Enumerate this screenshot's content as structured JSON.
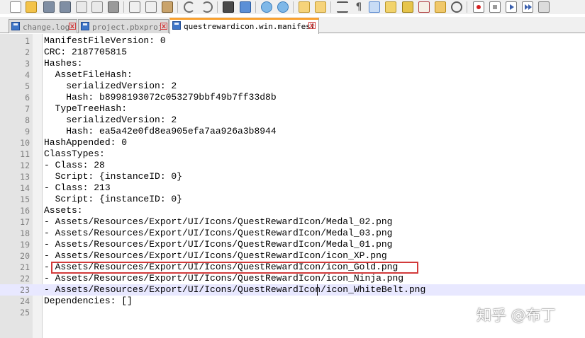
{
  "toolbar": {
    "icons": [
      "new-file-icon",
      "open-file-icon",
      "save-icon",
      "save-all-icon",
      "close-icon",
      "close-all-icon",
      "print-icon",
      "cut-icon",
      "copy-icon",
      "paste-icon",
      "undo-icon",
      "redo-icon",
      "find-icon",
      "replace-icon",
      "zoom-in-icon",
      "zoom-out-icon",
      "sync-vertical-icon",
      "sync-horizontal-icon",
      "word-wrap-icon",
      "show-all-characters-icon",
      "indent-guide-icon",
      "document-map-icon",
      "function-list-icon",
      "folder-as-workspace-icon",
      "monitoring-icon",
      "record-macro-icon",
      "stop-macro-icon",
      "play-macro-icon",
      "run-macro-multiple-icon",
      "save-macro-icon"
    ]
  },
  "tabs": [
    {
      "label": "change.log",
      "active": false
    },
    {
      "label": "project.pbxproj",
      "active": false
    },
    {
      "label": "questrewardicon.win.manifest",
      "active": true
    }
  ],
  "editor": {
    "current_line": 23,
    "highlighted_line": 21,
    "lines": [
      {
        "n": "1",
        "text": "ManifestFileVersion: 0"
      },
      {
        "n": "2",
        "text": "CRC: 2187705815"
      },
      {
        "n": "3",
        "text": "Hashes:"
      },
      {
        "n": "4",
        "text": "  AssetFileHash:"
      },
      {
        "n": "5",
        "text": "    serializedVersion: 2"
      },
      {
        "n": "6",
        "text": "    Hash: b8998193072c053279bbf49b7ff33d8b"
      },
      {
        "n": "7",
        "text": "  TypeTreeHash:"
      },
      {
        "n": "8",
        "text": "    serializedVersion: 2"
      },
      {
        "n": "9",
        "text": "    Hash: ea5a42e0fd8ea905efa7aa926a3b8944"
      },
      {
        "n": "10",
        "text": "HashAppended: 0"
      },
      {
        "n": "11",
        "text": "ClassTypes:"
      },
      {
        "n": "12",
        "text": "- Class: 28"
      },
      {
        "n": "13",
        "text": "  Script: {instanceID: 0}"
      },
      {
        "n": "14",
        "text": "- Class: 213"
      },
      {
        "n": "15",
        "text": "  Script: {instanceID: 0}"
      },
      {
        "n": "16",
        "text": "Assets:"
      },
      {
        "n": "17",
        "text": "- Assets/Resources/Export/UI/Icons/QuestRewardIcon/Medal_02.png"
      },
      {
        "n": "18",
        "text": "- Assets/Resources/Export/UI/Icons/QuestRewardIcon/Medal_03.png"
      },
      {
        "n": "19",
        "text": "- Assets/Resources/Export/UI/Icons/QuestRewardIcon/Medal_01.png"
      },
      {
        "n": "20",
        "text": "- Assets/Resources/Export/UI/Icons/QuestRewardIcon/icon_XP.png"
      },
      {
        "n": "21",
        "text": "- Assets/Resources/Export/UI/Icons/QuestRewardIcon/icon_Gold.png"
      },
      {
        "n": "22",
        "text": "- Assets/Resources/Export/UI/Icons/QuestRewardIcon/icon_Ninja.png"
      },
      {
        "n": "23",
        "text": "- Assets/Resources/Export/UI/Icons/QuestRewardIcon/icon_WhiteBelt.png"
      },
      {
        "n": "24",
        "text": "Dependencies: []"
      },
      {
        "n": "25",
        "text": ""
      }
    ]
  },
  "watermark": "知乎 @布丁",
  "colors": {
    "highlight_box": "#d23a3a",
    "active_tab_accent": "#f9a130",
    "current_line": "#e8e8ff"
  }
}
